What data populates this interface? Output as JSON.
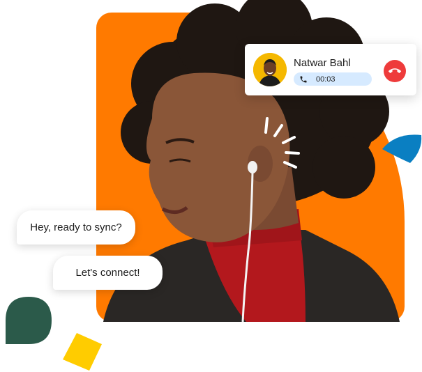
{
  "call": {
    "caller_name": "Natwar Bahl",
    "duration": "00:03",
    "avatar_bg": "#f5b800",
    "pill_bg": "#d6eaff",
    "end_button_color": "#ee3b3b",
    "icons": {
      "phone": "phone-icon",
      "end": "phone-hangup-icon"
    }
  },
  "chat": {
    "messages": [
      {
        "text": "Hey, ready to sync?"
      },
      {
        "text": "Let's connect!"
      }
    ]
  },
  "colors": {
    "backdrop": "#ff7a00",
    "blue_shape": "#0a7fc2",
    "green_shape": "#2b5a4a",
    "yellow_shape": "#ffcc00"
  }
}
